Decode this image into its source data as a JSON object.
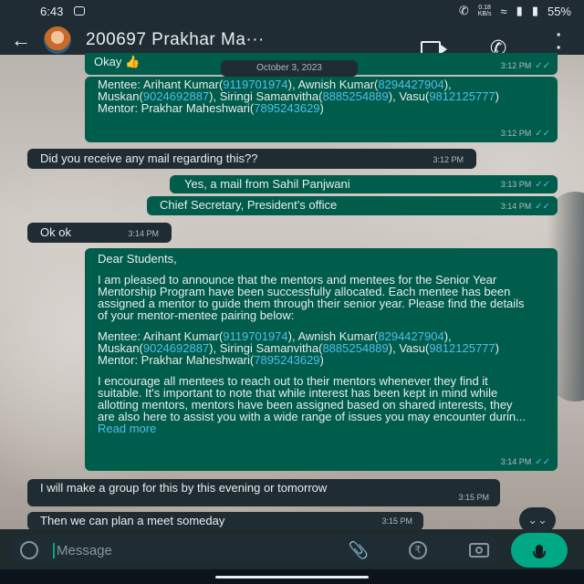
{
  "status_bar": {
    "time": "6:43",
    "speed_value": "0.18",
    "speed_unit": "KB/s",
    "battery": "55%"
  },
  "header": {
    "contact_name": "200697 Prakhar Ma···"
  },
  "date_chip": "October 3, 2023",
  "messages": [
    {
      "text": "Okay 👍",
      "time": "3:12 PM"
    },
    {
      "mentees_label": "Mentee: Arihant Kumar(",
      "tel1": "9119701974",
      "part2": "), Awnish Kumar(",
      "tel2": "8294427904",
      "part3": "), Muskan(",
      "tel3": "9024692887",
      "part4": "), Siringi Samanvitha(",
      "tel4": "8885254889",
      "part5": "), Vasu(",
      "tel5": "9812125777",
      "part6": ")",
      "mentor_label": "Mentor: Prakhar Maheshwari(",
      "tel6": "7895243629",
      "time": "3:12 PM"
    },
    {
      "text": "Did you receive any mail regarding this??",
      "time": "3:12 PM"
    },
    {
      "text": "Yes, a mail from Sahil Panjwani",
      "time": "3:13 PM"
    },
    {
      "text": "Chief Secretary, President's office",
      "time": "3:14 PM"
    },
    {
      "text": "Ok ok",
      "time": "3:14 PM"
    },
    {
      "greeting": "Dear Students,",
      "para1": "I am pleased to announce that the mentors and mentees for the Senior Year Mentorship Program have been successfully allocated. Each mentee has been assigned a mentor to guide them through their senior year. Please find the details of your mentor-mentee pairing below:",
      "para3": "I encourage all mentees to reach out to their mentors whenever they find it suitable. It's important to note that while interest has been kept in mind while allotting mentors, mentors have been assigned based on shared interests, they are also here to assist you with a wide range of issues you may encounter durin...",
      "read_more": "Read more",
      "time": "3:14 PM"
    },
    {
      "text": "I will make a group for this by this evening or tomorrow",
      "time": "3:15 PM"
    },
    {
      "text": "Then we can plan a meet someday",
      "time": "3:15 PM"
    }
  ],
  "input": {
    "placeholder": "Message"
  },
  "icons": {
    "back": "arrow-left-icon",
    "video": "video-call-icon",
    "call": "phone-icon",
    "menu": "more-vert-icon",
    "emoji": "emoji-icon",
    "attach": "paperclip-icon",
    "payment": "rupee-icon",
    "camera": "camera-icon",
    "mic": "mic-icon",
    "scroll": "double-chevron-down-icon"
  },
  "colors": {
    "outgoing_bubble": "#005c4b",
    "incoming_bubble": "#202c33",
    "accent": "#00a884",
    "link": "#53bdeb"
  }
}
